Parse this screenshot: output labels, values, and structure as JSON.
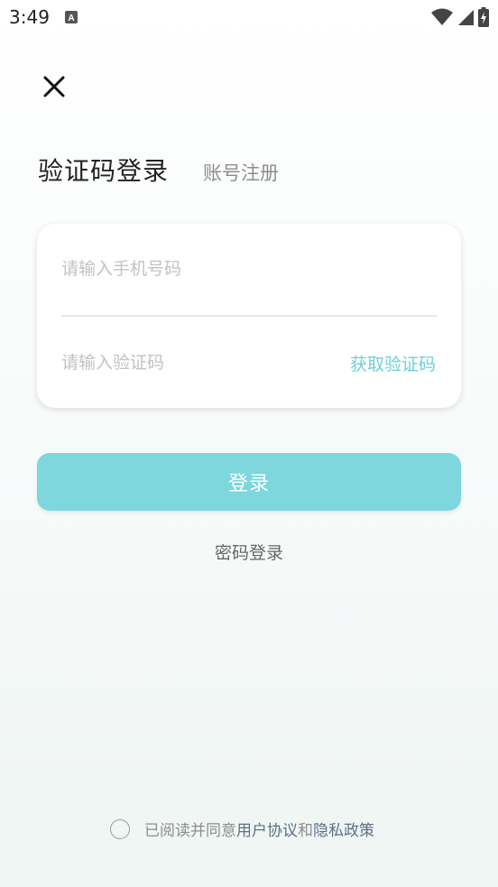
{
  "status_bar": {
    "time": "3:49",
    "app_icon": "text-format-icon",
    "wifi_icon": "wifi-icon",
    "signal_icon": "cell-signal-icon",
    "battery_icon": "battery-charging-icon"
  },
  "header": {
    "close_icon": "close-icon",
    "tab_active": "验证码登录",
    "tab_inactive": "账号注册"
  },
  "form": {
    "phone_placeholder": "请输入手机号码",
    "phone_value": "",
    "code_placeholder": "请输入验证码",
    "code_value": "",
    "get_code_label": "获取验证码"
  },
  "actions": {
    "login_label": "登录",
    "password_login_label": "密码登录"
  },
  "agreement": {
    "prefix": "已阅读并同意",
    "user_agreement": "用户协议",
    "and": "和",
    "privacy_policy": "隐私政策",
    "checked": false
  },
  "colors": {
    "accent": "#7dd7dd",
    "link": "#6fd0d4",
    "agreement_link": "#5d6f88"
  }
}
